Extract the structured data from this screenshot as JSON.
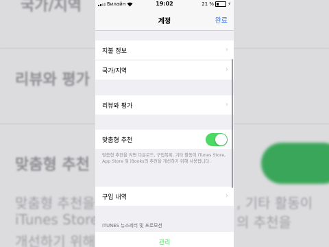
{
  "status_bar": {
    "carrier": "Билайн",
    "time": "19:02",
    "battery": "21 %"
  },
  "nav": {
    "title": "계정",
    "done_label": "완료"
  },
  "rows": {
    "payment": "지불 정보",
    "country": "국가/지역",
    "reviews": "리뷰와 평가",
    "personalized": "맞춤형 추천",
    "purchases": "구입 내역"
  },
  "personalized_note": "맞춤형 추천을 켜면 다운로드, 구입목록, 기타 활동이 iTunes Store, App Store 및 iBooks의 추천을 개선하기 위해 사용됩니다.",
  "newsletter_header": "ITUNES 뉴스레터 및 프로모션",
  "manage_label": "관리",
  "personalized_toggle_on": true,
  "backdrop": {
    "left_line1": "국가/지역",
    "left_line2": "리뷰와 평가",
    "left_line3": "맞춤형 추천",
    "left_line4": "맞춤형 추천을",
    "left_line5": "iTunes Store",
    "left_line6": "개선하기 위해",
    "right_line4": ", 기타 활동이",
    "right_line5": "의 추천을"
  }
}
